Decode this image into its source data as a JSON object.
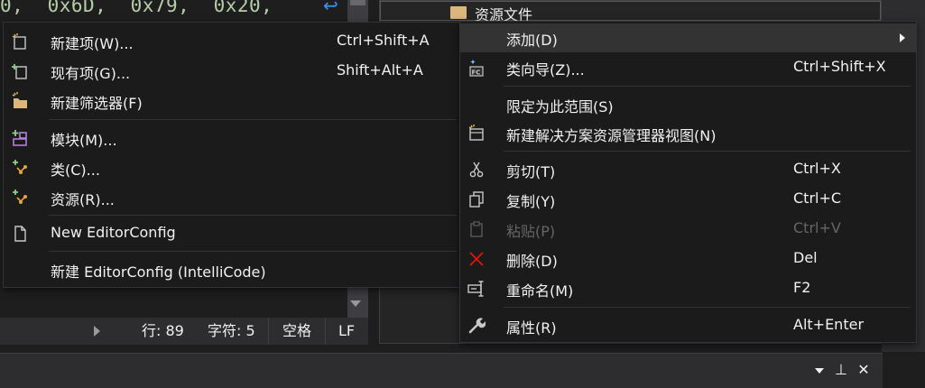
{
  "editor": {
    "code_fragment": "0,  0x6D,  0x79,  0x20,",
    "wrap_glyph": "↩"
  },
  "status_bar": {
    "line": "行: 89",
    "char": "字符: 5",
    "indent": "空格",
    "eol": "LF"
  },
  "explorer": {
    "selected_item": "资源文件"
  },
  "tool_window": {
    "pin_glyph": "⊥",
    "close_glyph": "✕"
  },
  "submenu": {
    "items": [
      {
        "label": "新建项(W)...",
        "accel": "Ctrl+Shift+A",
        "icon": "new-item-icon"
      },
      {
        "label": "现有项(G)...",
        "accel": "Shift+Alt+A",
        "icon": "existing-item-icon"
      },
      {
        "label": "新建筛选器(F)",
        "accel": "",
        "icon": "new-filter-icon"
      },
      {
        "label": "模块(M)...",
        "accel": "",
        "icon": "module-icon"
      },
      {
        "label": "类(C)...",
        "accel": "",
        "icon": "class-icon"
      },
      {
        "label": "资源(R)...",
        "accel": "",
        "icon": "resource-icon"
      },
      {
        "label": "New EditorConfig",
        "accel": "",
        "icon": "file-icon"
      },
      {
        "label": "新建 EditorConfig (IntelliCode)",
        "accel": "",
        "icon": ""
      }
    ]
  },
  "context_menu": {
    "items": [
      {
        "label": "添加(D)",
        "accel": "",
        "icon": "",
        "submenu": true
      },
      {
        "label": "类向导(Z)...",
        "accel": "Ctrl+Shift+X",
        "icon": "class-wizard-icon"
      },
      {
        "label": "限定为此范围(S)",
        "accel": "",
        "icon": ""
      },
      {
        "label": "新建解决方案资源管理器视图(N)",
        "accel": "",
        "icon": "new-view-icon"
      },
      {
        "label": "剪切(T)",
        "accel": "Ctrl+X",
        "icon": "scissors-icon"
      },
      {
        "label": "复制(Y)",
        "accel": "Ctrl+C",
        "icon": "copy-icon"
      },
      {
        "label": "粘贴(P)",
        "accel": "Ctrl+V",
        "icon": "paste-icon",
        "disabled": true
      },
      {
        "label": "删除(D)",
        "accel": "Del",
        "icon": "delete-icon"
      },
      {
        "label": "重命名(M)",
        "accel": "F2",
        "icon": "rename-icon"
      },
      {
        "label": "属性(R)",
        "accel": "Alt+Enter",
        "icon": "wrench-icon"
      }
    ]
  },
  "colors": {
    "menu_bg": "#1b1b1c",
    "highlight": "#333334",
    "delete_red": "#e51400",
    "add_green": "#89d185",
    "folder_yellow": "#dcb67a"
  }
}
